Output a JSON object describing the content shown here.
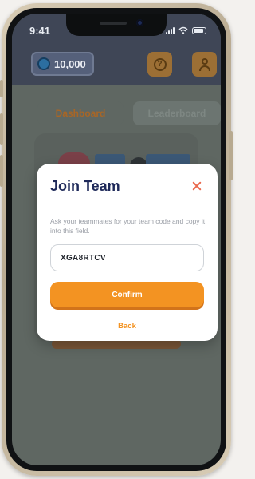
{
  "status_bar": {
    "time": "9:41"
  },
  "header": {
    "coins": "10,000",
    "help_symbol": "?"
  },
  "tabs": [
    {
      "label": "Dashboard",
      "active": true
    },
    {
      "label": "Leaderboard",
      "active": false
    }
  ],
  "modal": {
    "title": "Join Team",
    "description": "Ask your teammates for your team code and copy it into this field.",
    "code_value": "XGA8RTCV",
    "confirm_label": "Confirm",
    "back_label": "Back"
  },
  "icons": {
    "close": "close-icon",
    "help": "help-icon",
    "profile": "profile-icon",
    "coin": "coin-icon"
  },
  "colors": {
    "accent": "#f39322",
    "title": "#1f2a5a",
    "close": "#ea6a4f"
  }
}
